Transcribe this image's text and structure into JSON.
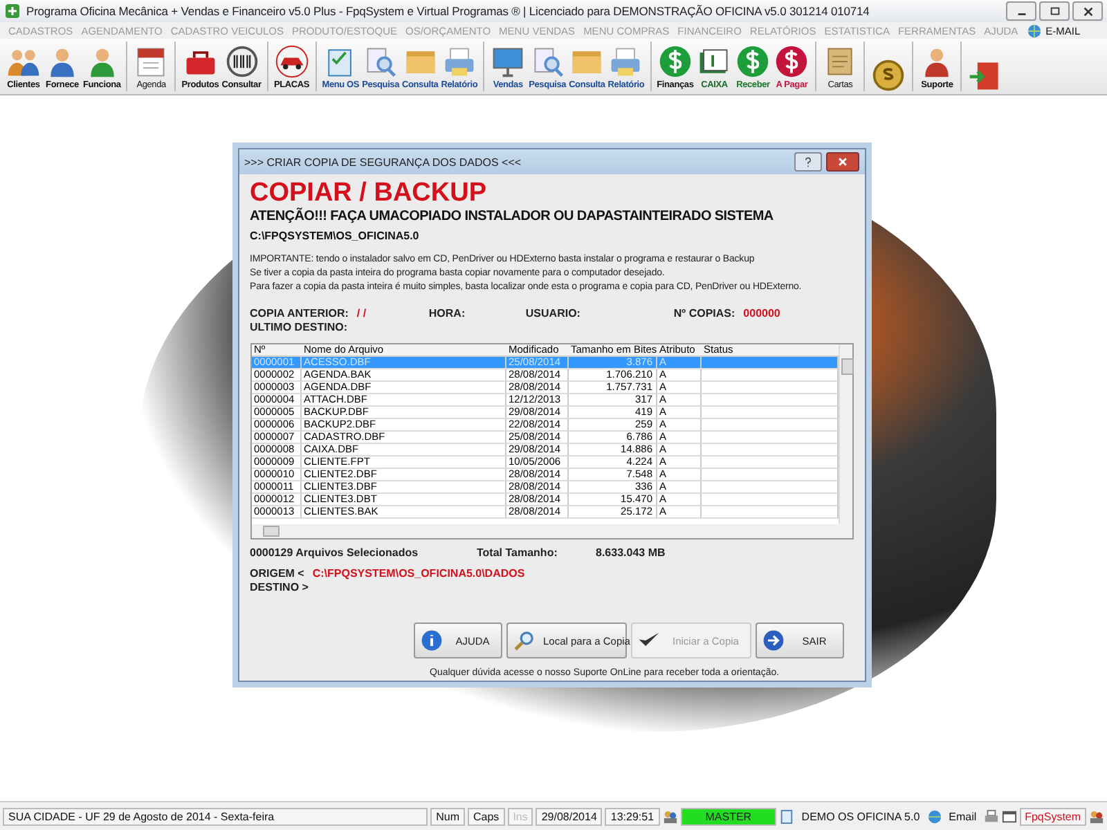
{
  "window": {
    "title": "Programa Oficina Mecânica + Vendas e Financeiro v5.0 Plus - FpqSystem e Virtual Programas ® | Licenciado para  DEMONSTRAÇÃO OFICINA v5.0 301214 010714"
  },
  "menu": [
    "CADASTROS",
    "AGENDAMENTO",
    "CADASTRO VEICULOS",
    "PRODUTO/ESTOQUE",
    "OS/ORÇAMENTO",
    "MENU VENDAS",
    "MENU COMPRAS",
    "FINANCEIRO",
    "RELATÓRIOS",
    "ESTATISTICA",
    "FERRAMENTAS",
    "AJUDA"
  ],
  "menu_email": "E-MAIL",
  "toolbar": [
    [
      {
        "label": "Clientes"
      },
      {
        "label": "Fornece"
      },
      {
        "label": "Funciona"
      }
    ],
    [
      {
        "label": "Agenda"
      }
    ],
    [
      {
        "label": "Produtos"
      },
      {
        "label": "Consultar"
      }
    ],
    [
      {
        "label": "PLACAS"
      }
    ],
    [
      {
        "label": "Menu OS"
      },
      {
        "label": "Pesquisa"
      },
      {
        "label": "Consulta"
      },
      {
        "label": "Relatório"
      }
    ],
    [
      {
        "label": "Vendas"
      },
      {
        "label": "Pesquisa"
      },
      {
        "label": "Consulta"
      },
      {
        "label": "Relatório"
      }
    ],
    [
      {
        "label": "Finanças"
      },
      {
        "label": "CAIXA"
      },
      {
        "label": "Receber"
      },
      {
        "label": "A Pagar"
      }
    ],
    [
      {
        "label": "Cartas"
      }
    ],
    [
      {
        "label": "Suporte"
      }
    ]
  ],
  "dialog": {
    "title": ">>> CRIAR COPIA DE SEGURANÇA DOS DADOS <<<",
    "heading": "COPIAR / BACKUP",
    "warning": "ATENÇÃO!!!   FAÇA UMACOPIADO INSTALADOR OU DAPASTAINTEIRADO SISTEMA",
    "path": "C:\\FPQSYSTEM\\OS_OFICINA5.0",
    "notes": [
      "IMPORTANTE: tendo o instalador salvo em CD, PenDriver ou HDExterno basta instalar o programa e restaurar o Backup",
      "Se tiver a copia da pasta inteira do programa basta copiar novamente para o computador desejado.",
      "Para fazer a copia da pasta inteira é muito simples, basta localizar onde esta o programa e copia para CD, PenDriver ou HDExterno."
    ],
    "copia_anterior_label": "COPIA ANTERIOR:",
    "copia_anterior": "/ /",
    "hora_label": "HORA:",
    "usuario_label": "USUARIO:",
    "copias_label": "Nº COPIAS:",
    "copias": "000000",
    "ultimo_destino_label": "ULTIMO DESTINO:",
    "table": {
      "columns": [
        "Nº",
        "Nome do Arquivo",
        "Modificado",
        "Tamanho em Bites",
        "Atributo",
        "Status"
      ],
      "rows": [
        {
          "cells": [
            "0000001",
            "ACESSO.DBF",
            "25/08/2014",
            "3.876",
            "A",
            ""
          ],
          "selected": true
        },
        {
          "cells": [
            "0000002",
            "AGENDA.BAK",
            "28/08/2014",
            "1.706.210",
            "A",
            ""
          ],
          "selected": false
        },
        {
          "cells": [
            "0000003",
            "AGENDA.DBF",
            "28/08/2014",
            "1.757.731",
            "A",
            ""
          ],
          "selected": false
        },
        {
          "cells": [
            "0000004",
            "ATTACH.DBF",
            "12/12/2013",
            "317",
            "A",
            ""
          ],
          "selected": false
        },
        {
          "cells": [
            "0000005",
            "BACKUP.DBF",
            "29/08/2014",
            "419",
            "A",
            ""
          ],
          "selected": false
        },
        {
          "cells": [
            "0000006",
            "BACKUP2.DBF",
            "22/08/2014",
            "259",
            "A",
            ""
          ],
          "selected": false
        },
        {
          "cells": [
            "0000007",
            "CADASTRO.DBF",
            "25/08/2014",
            "6.786",
            "A",
            ""
          ],
          "selected": false
        },
        {
          "cells": [
            "0000008",
            "CAIXA.DBF",
            "29/08/2014",
            "14.886",
            "A",
            ""
          ],
          "selected": false
        },
        {
          "cells": [
            "0000009",
            "CLIENTE.FPT",
            "10/05/2006",
            "4.224",
            "A",
            ""
          ],
          "selected": false
        },
        {
          "cells": [
            "0000010",
            "CLIENTE2.DBF",
            "28/08/2014",
            "7.548",
            "A",
            ""
          ],
          "selected": false
        },
        {
          "cells": [
            "0000011",
            "CLIENTE3.DBF",
            "28/08/2014",
            "336",
            "A",
            ""
          ],
          "selected": false
        },
        {
          "cells": [
            "0000012",
            "CLIENTE3.DBT",
            "28/08/2014",
            "15.470",
            "A",
            ""
          ],
          "selected": false
        },
        {
          "cells": [
            "0000013",
            "CLIENTES.BAK",
            "28/08/2014",
            "25.172",
            "A",
            ""
          ],
          "selected": false
        }
      ]
    },
    "selected_count": "0000129 Arquivos  Selecionados",
    "total_label": "Total Tamanho:",
    "total": "8.633.043 MB",
    "origem_label": "ORIGEM  <",
    "origem": "C:\\FPQSYSTEM\\OS_OFICINA5.0\\DADOS",
    "destino_label": "DESTINO >",
    "buttons": [
      {
        "label": "AJUDA",
        "disabled": false
      },
      {
        "label": "Local para a Copia",
        "disabled": false
      },
      {
        "label": "Iniciar a Copia",
        "disabled": true
      },
      {
        "label": "SAIR",
        "disabled": false
      }
    ],
    "footer": "Qualquer dúvida acesse o nosso Suporte OnLine para receber toda a orientação."
  },
  "status_bar": {
    "city": "SUA CIDADE - UF 29 de Agosto de 2014 - Sexta-feira",
    "keys": [
      {
        "label": "Num",
        "disabled": false
      },
      {
        "label": "Caps",
        "disabled": false
      },
      {
        "label": "Ins",
        "disabled": true
      }
    ],
    "date": "29/08/2014",
    "time": "13:29:51",
    "user": "MASTER",
    "system": "DEMO OS OFICINA 5.0",
    "email": "Email",
    "brand": "FpqSystem"
  }
}
